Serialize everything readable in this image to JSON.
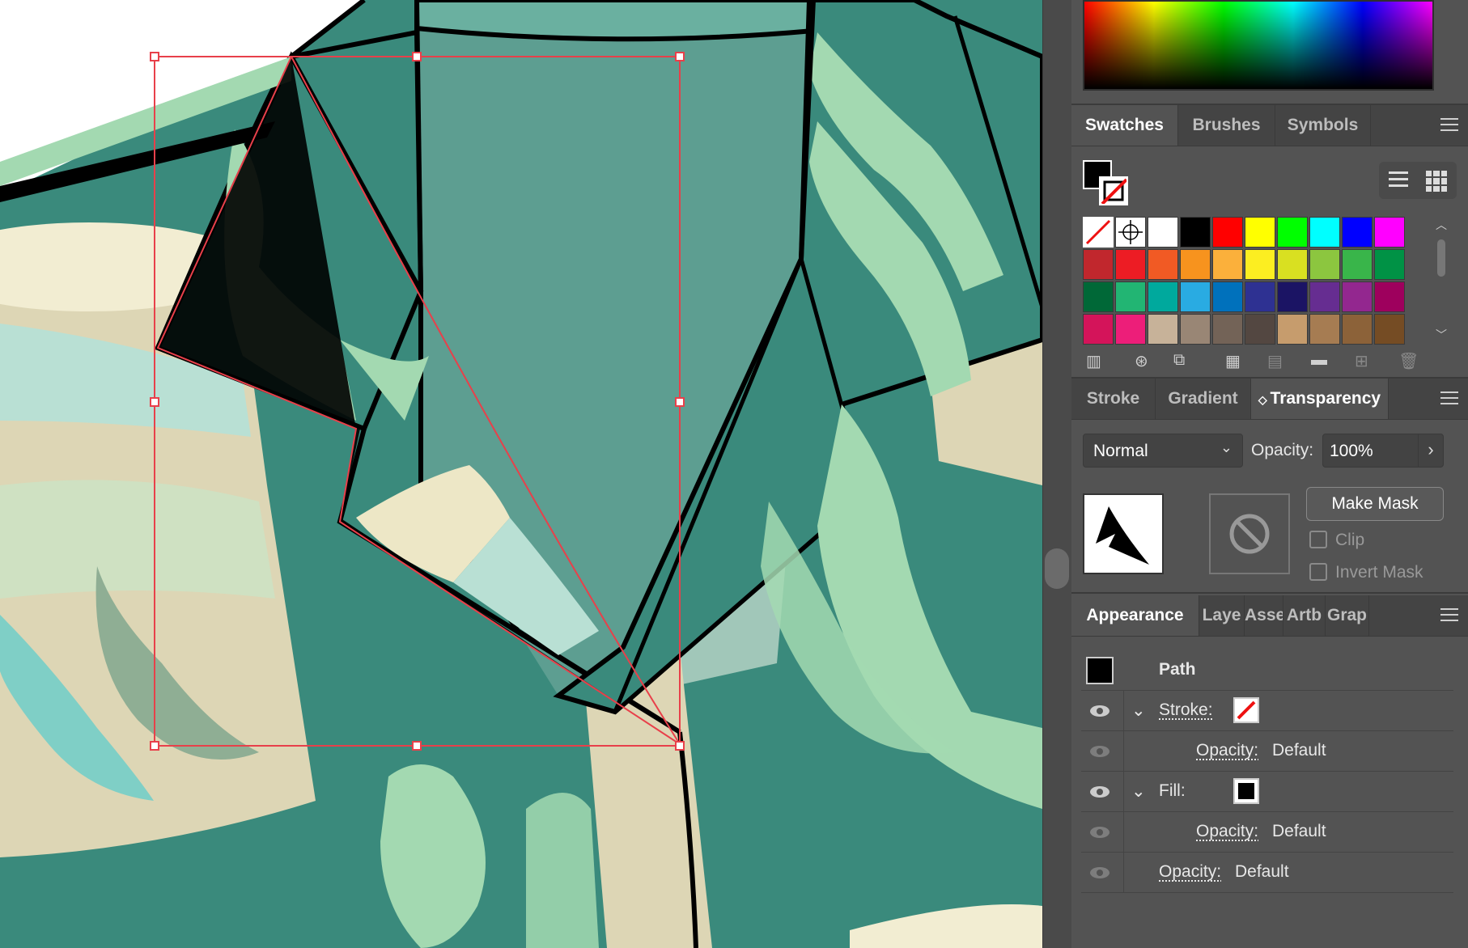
{
  "swatches_panel": {
    "tabs": [
      "Swatches",
      "Brushes",
      "Symbols"
    ],
    "active_tab": "Swatches",
    "rows": [
      [
        "none",
        "registration",
        "#ffffff",
        "#000000",
        "#ff0000",
        "#ffff00",
        "#00ff00",
        "#00ffff",
        "#0000ff",
        "#ff00ff"
      ],
      [
        "#c1272d",
        "#ed1c24",
        "#f15a24",
        "#f7931e",
        "#fbb03b",
        "#fcee21",
        "#d9e021",
        "#8cc63f",
        "#39b54a",
        "#009245"
      ],
      [
        "#006837",
        "#22b573",
        "#00a99d",
        "#29abe2",
        "#0071bc",
        "#2e3192",
        "#1b1464",
        "#662d91",
        "#93278f",
        "#9e005d"
      ],
      [
        "#d4145a",
        "#ed1e79",
        "#c7b299",
        "#998675",
        "#736357",
        "#534741",
        "#c69c6d",
        "#a67c52",
        "#8c6239",
        "#754c24"
      ]
    ]
  },
  "transparency_panel": {
    "tabs": [
      "Stroke",
      "Gradient",
      "Transparency"
    ],
    "active_tab": "Transparency",
    "blend_mode": "Normal",
    "opacity_label": "Opacity:",
    "opacity_value": "100%",
    "make_mask_label": "Make Mask",
    "clip_label": "Clip",
    "invert_mask_label": "Invert Mask"
  },
  "appearance_panel": {
    "tabs": [
      "Appearance",
      "Laye",
      "Asse",
      "Artb",
      "Grap"
    ],
    "active_tab": "Appearance",
    "object_label": "Path",
    "stroke_label": "Stroke:",
    "fill_label": "Fill:",
    "opacity_label": "Opacity:",
    "opacity_default": "Default"
  },
  "colors": {
    "panel_bg": "#535353",
    "tab_bg": "#444444",
    "selection": "#e8404a",
    "shirt_dark": "#3a8a7c",
    "shirt_mid": "#5d9e91",
    "leaf": "#a3d9b1",
    "cup": "#ddd6b5"
  }
}
